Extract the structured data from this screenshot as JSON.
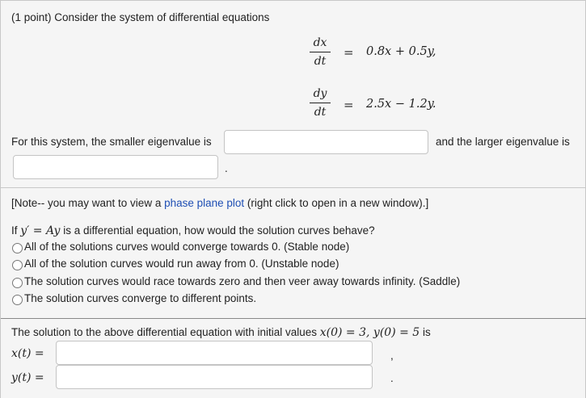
{
  "problem": {
    "header": "(1 point) Consider the system of differential equations",
    "eq1": {
      "num": "dx",
      "den": "dt",
      "eq": "=",
      "rhs": "0.8x + 0.5y,"
    },
    "eq2": {
      "num": "dy",
      "den": "dt",
      "eq": "=",
      "rhs": "2.5x − 1.2y."
    },
    "eigen_prompt": "For this system, the smaller eigenvalue is",
    "eigen_mid": "and the larger eigenvalue is",
    "eigen_end": "."
  },
  "note": {
    "prefix": "[Note-- you may want to view a ",
    "link": "phase plane plot",
    "suffix": " (right click to open in a new window).]"
  },
  "question": {
    "if": "If ",
    "yprime": "y′ = Ay",
    "rest": " is a differential equation, how would the solution curves behave?",
    "options": [
      "All of the solutions curves would converge towards 0. (Stable node)",
      "All of the solution curves would run away from 0. (Unstable node)",
      "The solution curves would race towards zero and then veer away towards infinity. (Saddle)",
      "The solution curves converge to different points."
    ]
  },
  "solution": {
    "prompt_prefix": "The solution to the above differential equation with initial values ",
    "initials": "x(0) = 3,  y(0) = 5",
    "prompt_suffix": " is",
    "x_label": "x(t) =",
    "x_end": ",",
    "y_label": "y(t) =",
    "y_end": "."
  }
}
